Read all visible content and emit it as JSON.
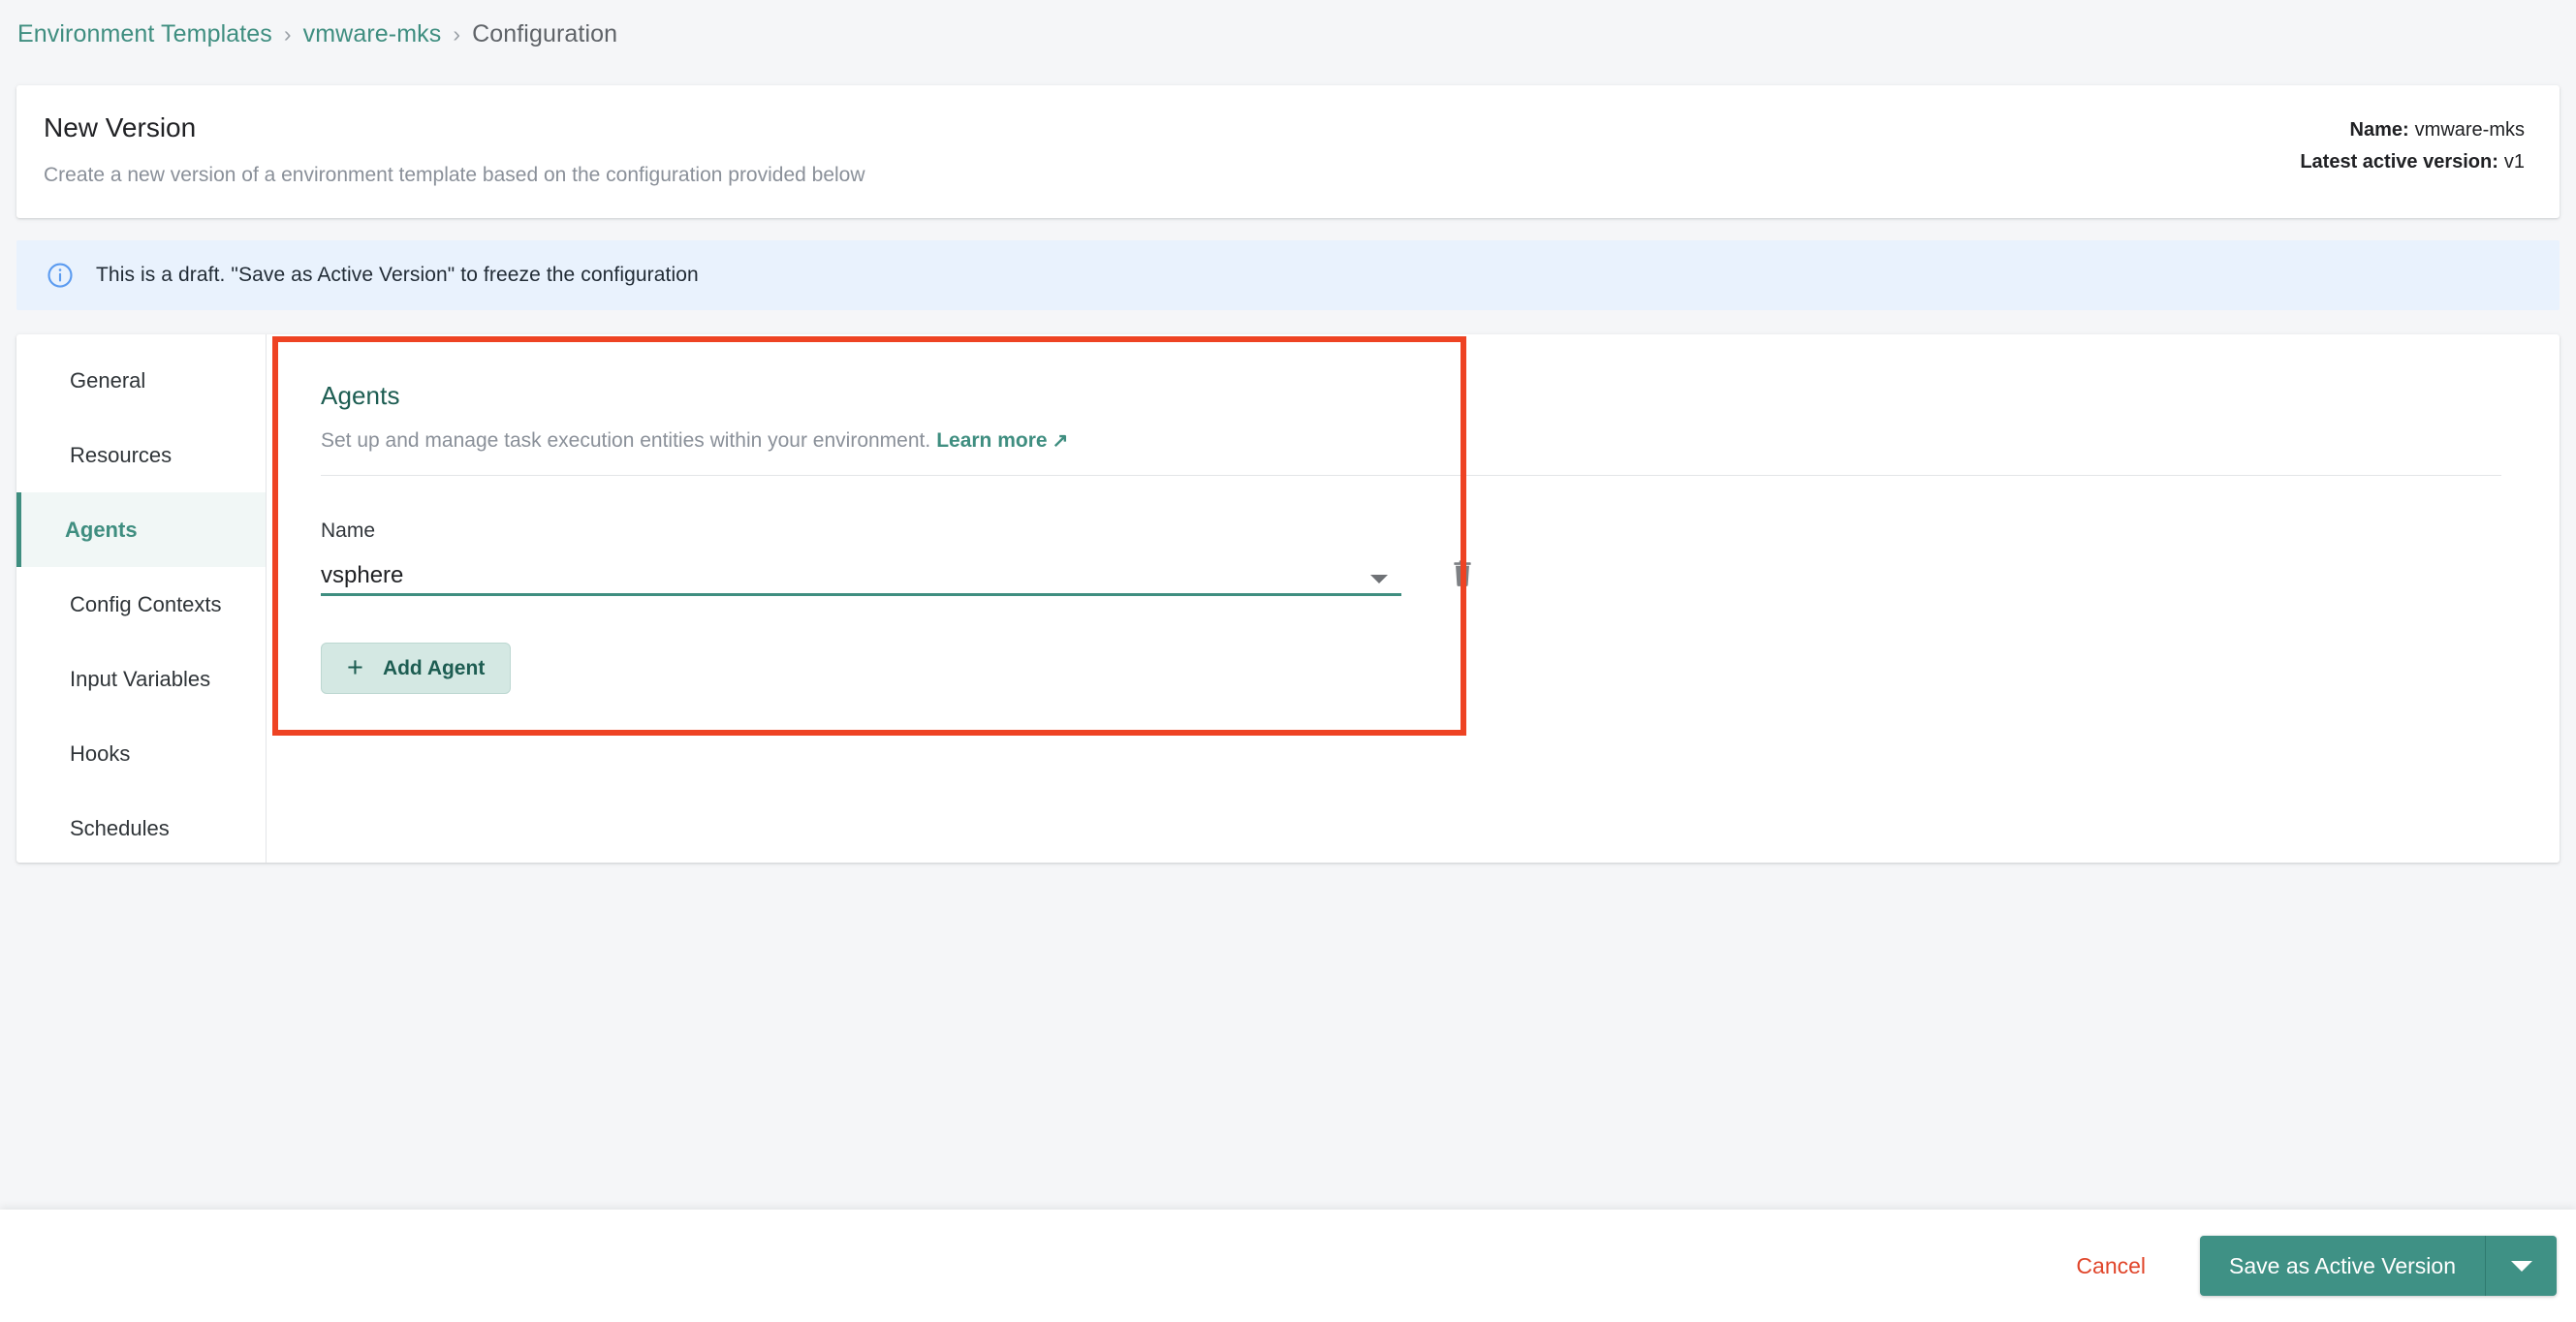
{
  "breadcrumb": {
    "items": [
      {
        "label": "Environment Templates",
        "current": false
      },
      {
        "label": "vmware-mks",
        "current": false
      },
      {
        "label": "Configuration",
        "current": true
      }
    ],
    "separator": "›"
  },
  "header": {
    "title": "New Version",
    "subtitle": "Create a new version of a environment template based on the configuration provided below",
    "meta": {
      "name_label": "Name:",
      "name_value": "vmware-mks",
      "version_label": "Latest active version:",
      "version_value": "v1"
    }
  },
  "banner": {
    "icon": "info-circle-icon",
    "text": "This is a draft. \"Save as Active Version\" to freeze the configuration",
    "background": "#e9f2fd",
    "icon_color": "#5b9bf0"
  },
  "sidebar": {
    "items": [
      {
        "label": "General",
        "active": false
      },
      {
        "label": "Resources",
        "active": false
      },
      {
        "label": "Agents",
        "active": true
      },
      {
        "label": "Config Contexts",
        "active": false
      },
      {
        "label": "Input Variables",
        "active": false
      },
      {
        "label": "Hooks",
        "active": false
      },
      {
        "label": "Schedules",
        "active": false
      }
    ],
    "active_color": "#3f8e80"
  },
  "panel": {
    "title": "Agents",
    "description": "Set up and manage task execution entities within your environment.",
    "learn_more_label": "Learn more",
    "learn_more_icon": "↗",
    "field": {
      "label": "Name",
      "value": "vsphere",
      "caret_icon": "chevron-down-icon",
      "delete_icon": "trash-icon"
    },
    "add_button": {
      "label": "Add Agent",
      "icon": "plus-icon"
    }
  },
  "annotation": {
    "color": "#ee4323"
  },
  "footer": {
    "cancel_label": "Cancel",
    "save_label": "Save as Active Version",
    "save_caret_icon": "chevron-down-icon",
    "save_color": "#3f9185",
    "cancel_color": "#e0452a"
  }
}
